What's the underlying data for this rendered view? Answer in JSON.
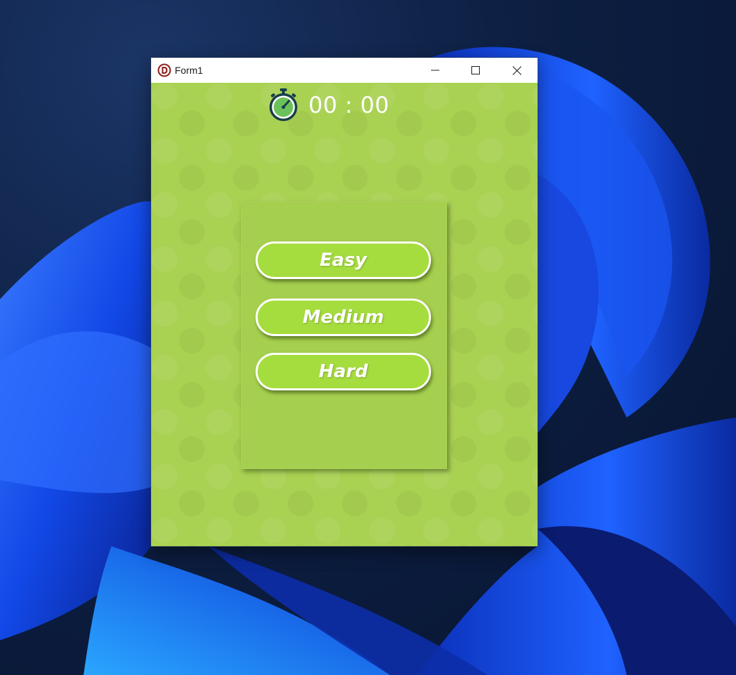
{
  "window": {
    "title": "Form1",
    "app_icon": "delphi-app-icon",
    "controls": {
      "minimize": "minimize-icon",
      "maximize": "maximize-icon",
      "close": "close-icon"
    }
  },
  "timer": {
    "icon": "stopwatch-icon",
    "value": "00 : 00"
  },
  "difficulty": {
    "options": [
      {
        "label": "Easy"
      },
      {
        "label": "Medium"
      },
      {
        "label": "Hard"
      }
    ]
  },
  "colors": {
    "background": "#a9d152",
    "card": "#a5cf4e",
    "button_fill": "#a6dd3e",
    "button_border": "#ffffff",
    "text": "#ffffff",
    "stopwatch_dark": "#173f4a",
    "stopwatch_face": "#6cc25a"
  }
}
